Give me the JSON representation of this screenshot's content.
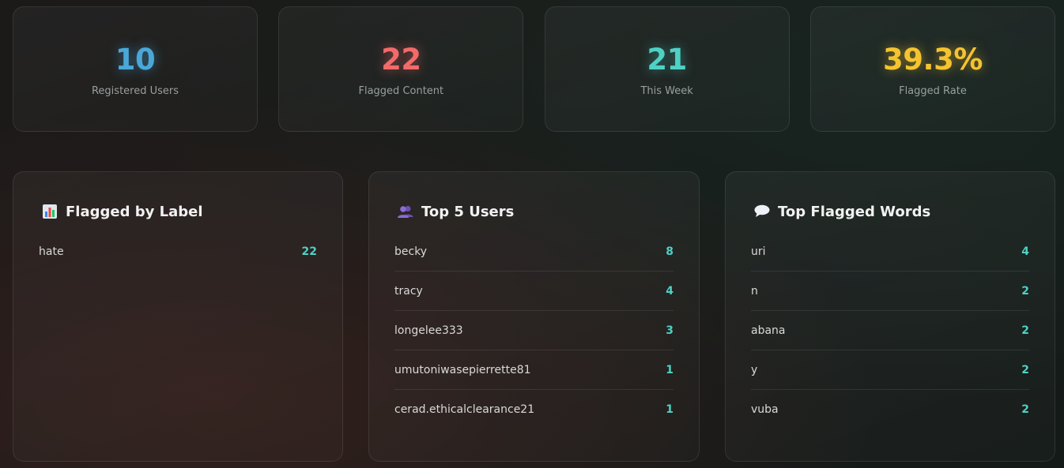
{
  "stats": [
    {
      "value": "10",
      "label": "Registered Users",
      "color": "#4aa8d8"
    },
    {
      "value": "22",
      "label": "Flagged Content",
      "color": "#f26a6a"
    },
    {
      "value": "21",
      "label": "This Week",
      "color": "#4fd1c5"
    },
    {
      "value": "39.3%",
      "label": "Flagged Rate",
      "color": "#f4c430"
    }
  ],
  "panels": {
    "labels": {
      "title": "Flagged by Label",
      "icon": "bar-chart-icon",
      "rows": [
        {
          "name": "hate",
          "count": "22"
        }
      ]
    },
    "users": {
      "title": "Top 5 Users",
      "icon": "users-icon",
      "rows": [
        {
          "name": "becky",
          "count": "8"
        },
        {
          "name": "tracy",
          "count": "4"
        },
        {
          "name": "longelee333",
          "count": "3"
        },
        {
          "name": "umutoniwasepierrette81",
          "count": "1"
        },
        {
          "name": "cerad.ethicalclearance21",
          "count": "1"
        }
      ]
    },
    "words": {
      "title": "Top Flagged Words",
      "icon": "speech-bubble-icon",
      "rows": [
        {
          "name": "uri",
          "count": "4"
        },
        {
          "name": "n",
          "count": "2"
        },
        {
          "name": "abana",
          "count": "2"
        },
        {
          "name": "y",
          "count": "2"
        },
        {
          "name": "vuba",
          "count": "2"
        }
      ]
    }
  },
  "colors": {
    "accent": "#4fd1c5"
  }
}
